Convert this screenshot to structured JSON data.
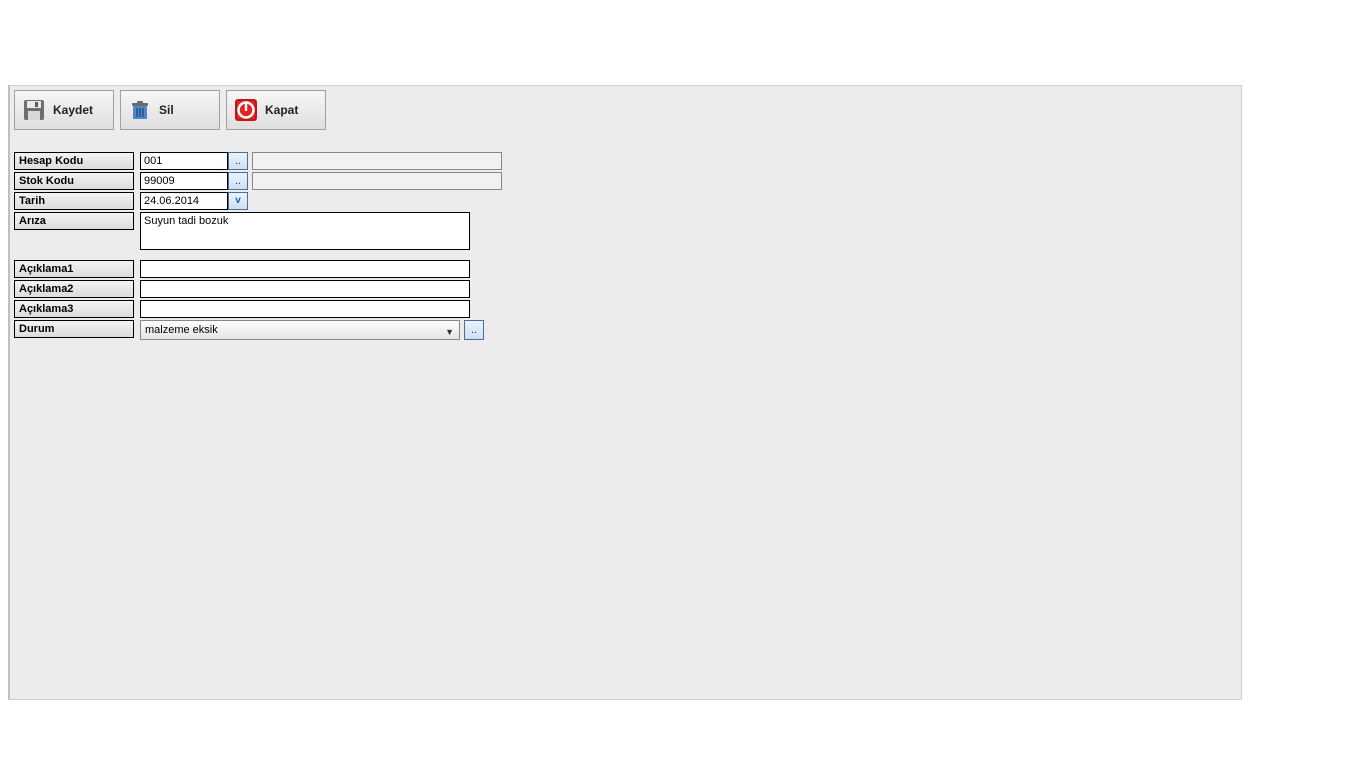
{
  "toolbar": {
    "kaydet_label": "Kaydet",
    "sil_label": "Sil",
    "kapat_label": "Kapat"
  },
  "labels": {
    "hesap_kodu": "Hesap Kodu",
    "stok_kodu": "Stok Kodu",
    "tarih": "Tarih",
    "ariza": "Arıza",
    "aciklama1": "Açıklama1",
    "aciklama2": "Açıklama2",
    "aciklama3": "Açıklama3",
    "durum": "Durum"
  },
  "fields": {
    "hesap_kodu": "001",
    "hesap_kodu_desc": "",
    "stok_kodu": "99009",
    "stok_kodu_desc": "",
    "tarih": "24.06.2014",
    "ariza": "Suyun tadi bozuk",
    "aciklama1": "",
    "aciklama2": "",
    "aciklama3": "",
    "durum": "malzeme eksik"
  },
  "buttons": {
    "lookup": "..",
    "date_drop": "v"
  }
}
